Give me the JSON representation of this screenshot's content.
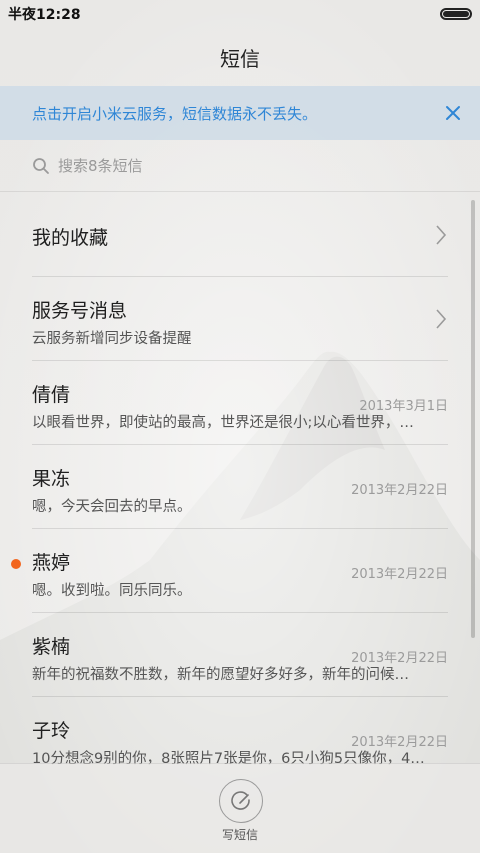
{
  "status_bar": {
    "time": "半夜12:28",
    "battery_level": 1.0
  },
  "header": {
    "title": "短信"
  },
  "banner": {
    "text": "点击开启小米云服务，短信数据永不丢失。",
    "accent_color": "#2f86d6"
  },
  "search": {
    "placeholder": "搜索8条短信"
  },
  "conversations": [
    {
      "name": "我的收藏",
      "preview": "",
      "date": "",
      "has_chevron": true,
      "unread": false
    },
    {
      "name": "服务号消息",
      "preview": "云服务新增同步设备提醒",
      "date": "",
      "has_chevron": true,
      "unread": false
    },
    {
      "name": "倩倩",
      "preview": "以眼看世界，即使站的最高，世界还是很小;以心看世界，…",
      "date": "2013年3月1日",
      "has_chevron": false,
      "unread": false
    },
    {
      "name": "果冻",
      "preview": "嗯，今天会回去的早点。",
      "date": "2013年2月22日",
      "has_chevron": false,
      "unread": false
    },
    {
      "name": "燕婷",
      "preview": "嗯。收到啦。同乐同乐。",
      "date": "2013年2月22日",
      "has_chevron": false,
      "unread": true
    },
    {
      "name": "紫楠",
      "preview": "新年的祝福数不胜数，新年的愿望好多好多，新年的问候…",
      "date": "2013年2月22日",
      "has_chevron": false,
      "unread": false
    },
    {
      "name": "子玲",
      "preview": "10分想念9别的你，8张照片7张是你，6只小狗5只像你，4…",
      "date": "2013年2月22日",
      "has_chevron": false,
      "unread": false
    }
  ],
  "bottom_bar": {
    "compose_label": "写短信"
  },
  "colors": {
    "unread_dot": "#f2651d"
  }
}
